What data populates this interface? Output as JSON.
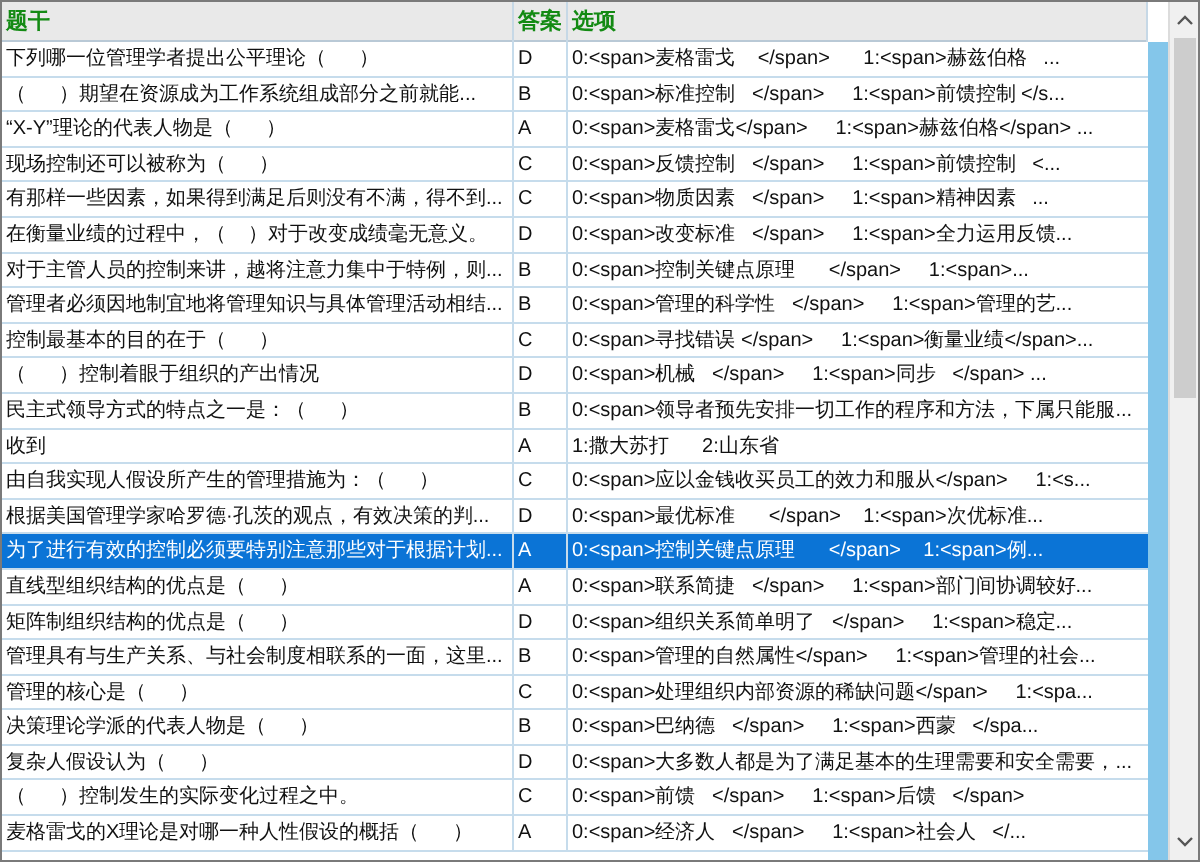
{
  "table": {
    "columns": [
      "题干",
      "答案",
      "选项"
    ],
    "rows": [
      {
        "question": "下列哪一位管理学者提出公平理论（      ）",
        "answer": "D",
        "options": "0:<span>麦格雷戈    </span>      1:<span>赫兹伯格   ...",
        "selected": false
      },
      {
        "question": "（      ）期望在资源成为工作系统组成部分之前就能...",
        "answer": "B",
        "options": "0:<span>标准控制   </span>     1:<span>前馈控制 </s...",
        "selected": false
      },
      {
        "question": "“X-Y”理论的代表人物是（      ）",
        "answer": "A",
        "options": "0:<span>麦格雷戈</span>     1:<span>赫兹伯格</span> ...",
        "selected": false
      },
      {
        "question": "现场控制还可以被称为（      ）",
        "answer": "C",
        "options": "0:<span>反馈控制   </span>     1:<span>前馈控制   <...",
        "selected": false
      },
      {
        "question": "有那样一些因素，如果得到满足后则没有不满，得不到...",
        "answer": "C",
        "options": "0:<span>物质因素   </span>     1:<span>精神因素   ...",
        "selected": false
      },
      {
        "question": "在衡量业绩的过程中，（    ）对于改变成绩毫无意义。",
        "answer": "D",
        "options": "0:<span>改变标准   </span>     1:<span>全力运用反馈...",
        "selected": false
      },
      {
        "question": "对于主管人员的控制来讲，越将注意力集中于特例，则...",
        "answer": "B",
        "options": "0:<span>控制关键点原理      </span>     1:<span>...",
        "selected": false
      },
      {
        "question": "管理者必须因地制宜地将管理知识与具体管理活动相结...",
        "answer": "B",
        "options": "0:<span>管理的科学性   </span>     1:<span>管理的艺...",
        "selected": false
      },
      {
        "question": "控制最基本的目的在于（      ）",
        "answer": "C",
        "options": "0:<span>寻找错误 </span>     1:<span>衡量业绩</span>...",
        "selected": false
      },
      {
        "question": "（      ）控制着眼于组织的产出情况",
        "answer": "D",
        "options": "0:<span>机械   </span>     1:<span>同步   </span> ...",
        "selected": false
      },
      {
        "question": "民主式领导方式的特点之一是：（      ）",
        "answer": "B",
        "options": "0:<span>领导者预先安排一切工作的程序和方法，下属只能服...",
        "selected": false
      },
      {
        "question": "收到",
        "answer": "A",
        "options": "1:撒大苏打      2:山东省",
        "selected": false
      },
      {
        "question": "由自我实现人假设所产生的管理措施为：（      ）",
        "answer": "C",
        "options": "0:<span>应以金钱收买员工的效力和服从</span>     1:<s...",
        "selected": false
      },
      {
        "question": "根据美国管理学家哈罗德·孔茨的观点，有效决策的判...",
        "answer": "D",
        "options": "0:<span>最优标准      </span>    1:<span>次优标准...",
        "selected": false
      },
      {
        "question": "为了进行有效的控制必须要特别注意那些对于根据计划...",
        "answer": "A",
        "options": "0:<span>控制关键点原理      </span>    1:<span>例...",
        "selected": true
      },
      {
        "question": "直线型组织结构的优点是（      ）",
        "answer": "A",
        "options": "0:<span>联系简捷   </span>     1:<span>部门间协调较好...",
        "selected": false
      },
      {
        "question": "矩阵制组织结构的优点是（      ）",
        "answer": "D",
        "options": "0:<span>组织关系简单明了   </span>     1:<span>稳定...",
        "selected": false
      },
      {
        "question": "管理具有与生产关系、与社会制度相联系的一面，这里...",
        "answer": "B",
        "options": "0:<span>管理的自然属性</span>     1:<span>管理的社会...",
        "selected": false
      },
      {
        "question": "管理的核心是（      ）",
        "answer": "C",
        "options": "0:<span>处理组织内部资源的稀缺问题</span>     1:<spa...",
        "selected": false
      },
      {
        "question": "决策理论学派的代表人物是（      ）",
        "answer": "B",
        "options": "0:<span>巴纳德   </span>     1:<span>西蒙   </spa...",
        "selected": false
      },
      {
        "question": "复杂人假设认为（      ）",
        "answer": "D",
        "options": "0:<span>大多数人都是为了满足基本的生理需要和安全需要，...",
        "selected": false
      },
      {
        "question": "（      ）控制发生的实际变化过程之中。",
        "answer": "C",
        "options": "0:<span>前馈   </span>     1:<span>后馈   </span>",
        "selected": false
      },
      {
        "question": "麦格雷戈的X理论是对哪一种人性假设的概括（      ）",
        "answer": "A",
        "options": "0:<span>经济人   </span>     1:<span>社会人   </...",
        "selected": false
      }
    ]
  }
}
